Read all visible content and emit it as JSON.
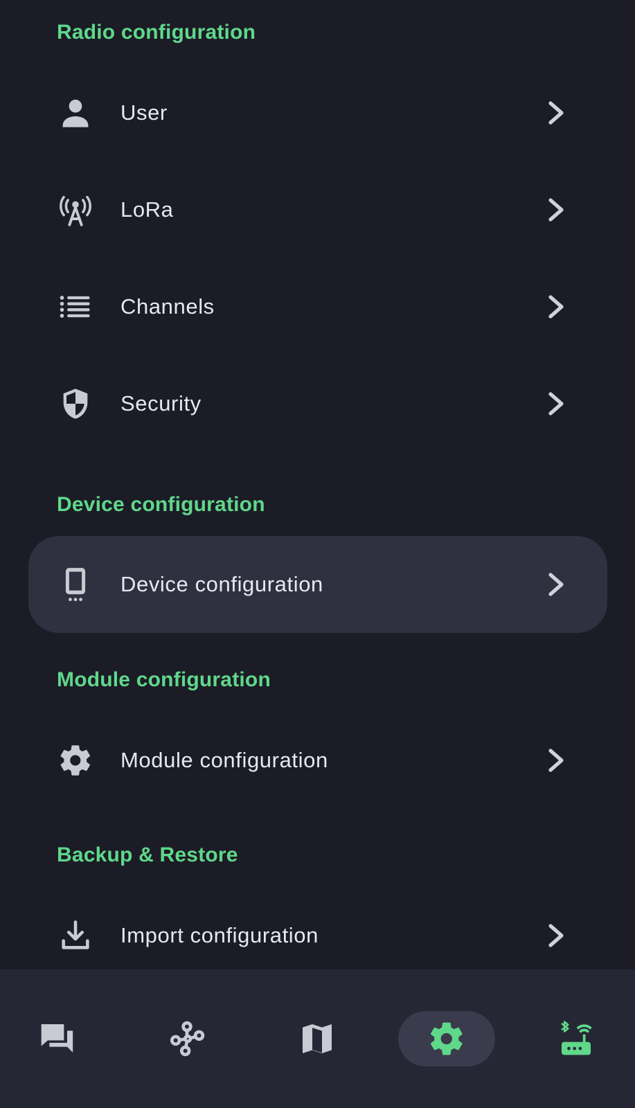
{
  "sections": {
    "radio": {
      "title": "Radio configuration",
      "items": [
        {
          "label": "User",
          "icon": "person-icon"
        },
        {
          "label": "LoRa",
          "icon": "antenna-icon"
        },
        {
          "label": "Channels",
          "icon": "list-icon"
        },
        {
          "label": "Security",
          "icon": "shield-icon"
        }
      ]
    },
    "device": {
      "title": "Device configuration",
      "items": [
        {
          "label": "Device configuration",
          "icon": "device-icon",
          "selected": true
        }
      ]
    },
    "module": {
      "title": "Module configuration",
      "items": [
        {
          "label": "Module configuration",
          "icon": "gear-icon"
        }
      ]
    },
    "backup": {
      "title": "Backup & Restore",
      "items": [
        {
          "label": "Import configuration",
          "icon": "download-icon"
        }
      ]
    }
  },
  "bottom_nav": {
    "items": [
      {
        "icon": "messages-icon",
        "active": false
      },
      {
        "icon": "nodes-icon",
        "active": false
      },
      {
        "icon": "map-icon",
        "active": false
      },
      {
        "icon": "settings-gear-icon",
        "active": true
      },
      {
        "icon": "bluetooth-router-icon",
        "active": false
      }
    ]
  },
  "colors": {
    "background": "#1b1c26",
    "accent": "#5fd88a",
    "selected_row": "#303140",
    "nav_background": "#262734",
    "icon": "#c9cad3"
  }
}
